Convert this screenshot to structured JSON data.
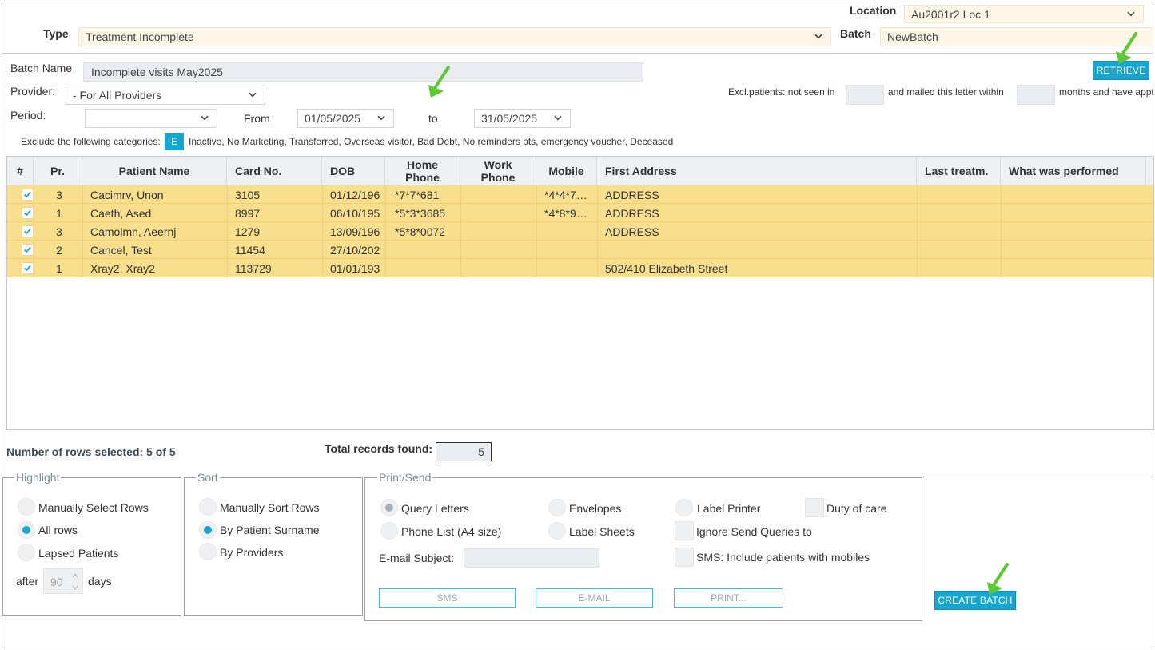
{
  "header": {
    "location_label": "Location",
    "location_value": "Au2001r2 Loc 1",
    "type_label": "Type",
    "type_value": "Treatment Incomplete",
    "batch_label": "Batch",
    "batch_value": "NewBatch"
  },
  "form": {
    "batch_name_label": "Batch Name",
    "batch_name_value": "Incomplete visits May2025",
    "provider_label": "Provider:",
    "provider_value": "- For All Providers",
    "period_label": "Period:",
    "period_value": "",
    "from_label": "From",
    "from_value": "01/05/2025",
    "to_label": "to",
    "to_value": "31/05/2025",
    "retrieve_label": "RETRIEVE",
    "excl_prefix": "Excl.patients: not seen in",
    "excl_middle": "and mailed this letter within",
    "excl_suffix": "months and have appt",
    "exclude_label": "Exclude the following categories:",
    "exclude_badge": "E",
    "exclude_list": "Inactive, No Marketing, Transferred, Overseas visitor, Bad Debt, No reminders pts, emergency voucher, Deceased"
  },
  "table": {
    "headers": [
      "#",
      "Pr.",
      "Patient Name",
      "Card No.",
      "DOB",
      "Home Phone",
      "Work Phone",
      "Mobile",
      "First Address",
      "Last treatm.",
      "What was performed"
    ],
    "rows": [
      {
        "pr": "3",
        "name": "Cacimrv, Unon",
        "card": "3105",
        "dob": "01/12/196",
        "home": "*7*7*681",
        "work": "",
        "mobile": "*4*4*7…",
        "address": "ADDRESS",
        "last": "",
        "performed": ""
      },
      {
        "pr": "1",
        "name": "Caeth, Ased",
        "card": "8997",
        "dob": "06/10/195",
        "home": "*5*3*3685",
        "work": "",
        "mobile": "*4*8*9…",
        "address": "ADDRESS",
        "last": "",
        "performed": ""
      },
      {
        "pr": "3",
        "name": "Camolmn, Aeernj",
        "card": "1279",
        "dob": "13/09/196",
        "home": "*5*8*0072",
        "work": "",
        "mobile": "",
        "address": "ADDRESS",
        "last": "",
        "performed": ""
      },
      {
        "pr": "2",
        "name": "Cancel, Test",
        "card": "11454",
        "dob": "27/10/202",
        "home": "",
        "work": "",
        "mobile": "",
        "address": "",
        "last": "",
        "performed": ""
      },
      {
        "pr": "1",
        "name": "Xray2, Xray2",
        "card": "113729",
        "dob": "01/01/193",
        "home": "",
        "work": "",
        "mobile": "",
        "address": "502/410 Elizabeth Street",
        "last": "",
        "performed": ""
      }
    ]
  },
  "summary": {
    "rows_selected": "Number of rows selected: 5 of 5",
    "total_label": "Total records found:",
    "total_value": "5"
  },
  "highlight": {
    "legend": "Highlight",
    "options": [
      "Manually Select Rows",
      "All rows",
      "Lapsed Patients"
    ],
    "selected": "All rows",
    "after_label": "after",
    "days_value": "90",
    "days_label": "days"
  },
  "sort": {
    "legend": "Sort",
    "options": [
      "Manually Sort Rows",
      "By Patient Surname",
      "By Providers"
    ],
    "selected": "By Patient Surname"
  },
  "print_send": {
    "legend": "Print/Send",
    "query_letters": "Query Letters",
    "envelopes": "Envelopes",
    "label_printer": "Label Printer",
    "duty_of_care": "Duty of care",
    "phone_list": "Phone List (A4 size)",
    "label_sheets": "Label Sheets",
    "ignore_send": "Ignore Send Queries to",
    "email_subject_label": "E-mail Subject:",
    "email_subject_value": "",
    "sms_include": "SMS: Include patients with mobiles",
    "sms_button": "SMS",
    "email_button": "E-MAIL",
    "print_button": "PRINT..."
  },
  "create_batch_label": "CREATE BATCH",
  "colors": {
    "accent": "#16a6cf",
    "row_highlight": "#f8df8e",
    "annotation_arrow": "#5cc832"
  }
}
